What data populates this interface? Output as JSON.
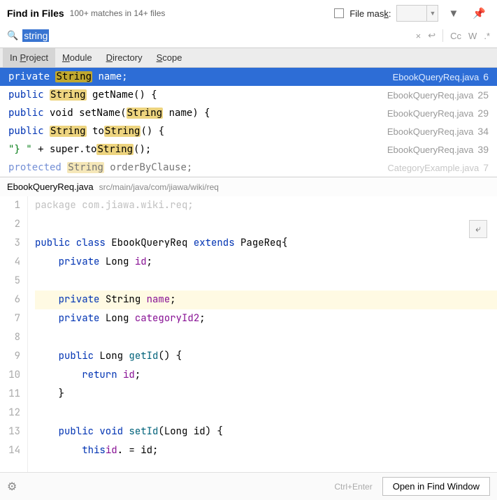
{
  "header": {
    "title": "Find in Files",
    "summary": "100+ matches in 14+ files",
    "file_mask_label": "File mask:"
  },
  "search": {
    "query": "string",
    "cc_label": "Cc",
    "w_label": "W",
    "regex_label": ".*"
  },
  "tabs": [
    {
      "label": "In Project",
      "underline": "P",
      "rest": "roject",
      "prefix": "In ",
      "active": true
    },
    {
      "label": "Module",
      "underline": "M",
      "rest": "odule",
      "prefix": "",
      "active": false
    },
    {
      "label": "Directory",
      "underline": "D",
      "rest": "irectory",
      "prefix": "",
      "active": false
    },
    {
      "label": "Scope",
      "underline": "S",
      "rest": "cope",
      "prefix": "",
      "active": false
    }
  ],
  "results": [
    {
      "preKw": "private",
      "preHl": " ",
      "hl": "String",
      "post": " name;",
      "file": "EbookQueryReq.java",
      "line": "6",
      "selected": true
    },
    {
      "preKw": "public",
      "preHl": " ",
      "hl": "String",
      "post": " getName() {",
      "file": "EbookQueryReq.java",
      "line": "25",
      "selected": false
    },
    {
      "preKw": "public",
      "preHl": " void setName(",
      "hl": "String",
      "post": " name) {",
      "file": "EbookQueryReq.java",
      "line": "29",
      "selected": false
    },
    {
      "preKw": "public",
      "preHl": " ",
      "hl": "String",
      "post": " to",
      "hl2": "String",
      "post2": "() {",
      "file": "EbookQueryReq.java",
      "line": "34",
      "selected": false
    },
    {
      "raw": true,
      "str": "\"} \"",
      "plain": " + super.to",
      "hl": "String",
      "post": "();",
      "file": "EbookQueryReq.java",
      "line": "39",
      "selected": false
    },
    {
      "preKw": "protected",
      "preHl": " ",
      "hl": "String",
      "post": " orderByClause;",
      "file": "CategoryExample.java",
      "line": "7",
      "selected": false,
      "faded": true
    }
  ],
  "preview": {
    "file": "EbookQueryReq.java",
    "path": "src/main/java/com/jiawa/wiki/req"
  },
  "code": {
    "lines": [
      {
        "n": "1",
        "html": "package com.jiawa.wiki.req;",
        "faded": true
      },
      {
        "n": "2",
        "html": ""
      },
      {
        "n": "3",
        "kw": "public class",
        "type": " EbookQueryReq ",
        "kw2": "extends",
        "type2": " PageReq{"
      },
      {
        "n": "4",
        "indent": "    ",
        "kw": "private",
        "type": " Long ",
        "field": "id",
        "tail": ";"
      },
      {
        "n": "5",
        "html": ""
      },
      {
        "n": "6",
        "hl": true,
        "indent": "    ",
        "kw": "private",
        "type": " String ",
        "field": "name",
        "tail": ";"
      },
      {
        "n": "7",
        "indent": "    ",
        "kw": "private",
        "type": " Long ",
        "field": "categoryId2",
        "tail": ";"
      },
      {
        "n": "8",
        "html": ""
      },
      {
        "n": "9",
        "indent": "    ",
        "kw": "public",
        "type": " Long ",
        "method": "getId",
        "tail": "() {"
      },
      {
        "n": "10",
        "indent": "        ",
        "kw": "return",
        "type": " ",
        "field": "id",
        "tail": ";"
      },
      {
        "n": "11",
        "indent": "    ",
        "tail": "}"
      },
      {
        "n": "12",
        "html": ""
      },
      {
        "n": "13",
        "indent": "    ",
        "kw": "public void",
        "type": " ",
        "method": "setId",
        "tail": "(Long id) {"
      },
      {
        "n": "14",
        "indent": "        ",
        "kw": "this",
        "tail": ".",
        "field": "id",
        "tail2": " = id;"
      }
    ]
  },
  "footer": {
    "hint": "Ctrl+Enter",
    "open_label": "Open in Find Window"
  }
}
